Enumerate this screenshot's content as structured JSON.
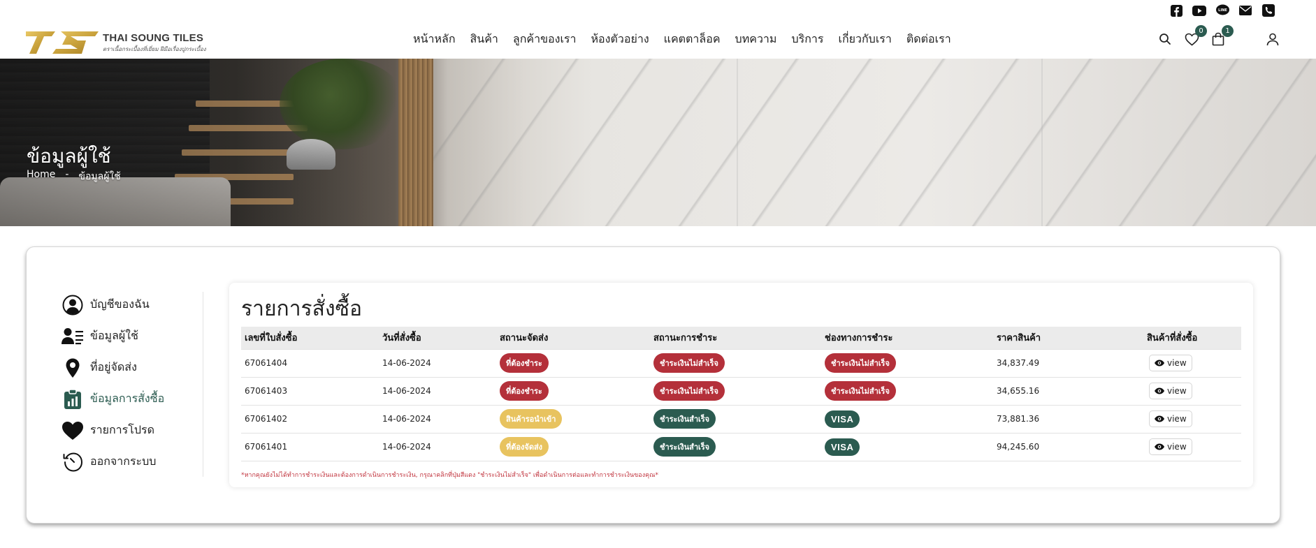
{
  "brand": {
    "name": "THAI SOUNG TILES",
    "tagline": "ตราเนื้อกระเบื้องที่เยี่ยม ฝีมือเรื่องปูกระเบื้อง",
    "accent": "#2b5b50",
    "gold": "#c9a23c"
  },
  "social": [
    "facebook-icon",
    "youtube-icon",
    "line-icon",
    "mail-icon",
    "phone-icon"
  ],
  "nav": [
    {
      "label": "หน้าหลัก"
    },
    {
      "label": "สินค้า"
    },
    {
      "label": "ลูกค้าของเรา"
    },
    {
      "label": "ห้องตัวอย่าง"
    },
    {
      "label": "แคตตาล็อค"
    },
    {
      "label": "บทความ"
    },
    {
      "label": "บริการ"
    },
    {
      "label": "เกี่ยวกับเรา"
    },
    {
      "label": "ติดต่อเรา"
    }
  ],
  "header": {
    "wishlist_count": "0",
    "cart_count": "1"
  },
  "hero": {
    "title": "ข้อมูลผู้ใช้",
    "breadcrumb_home": "Home",
    "breadcrumb_sep": "-",
    "breadcrumb_current": "ข้อมูลผู้ใช้"
  },
  "sidebar": {
    "items": [
      {
        "label": "บัญชีของฉัน",
        "icon": "account-circle-icon"
      },
      {
        "label": "ข้อมูลผู้ใช้",
        "icon": "user-details-icon"
      },
      {
        "label": "ที่อยู่จัดส่ง",
        "icon": "map-pin-icon"
      },
      {
        "label": "ข้อมูลการสั่งซื้อ",
        "icon": "order-clipboard-icon",
        "active": true
      },
      {
        "label": "รายการโปรด",
        "icon": "heart-icon"
      },
      {
        "label": "ออกจากระบบ",
        "icon": "logout-icon"
      }
    ]
  },
  "orders": {
    "title": "รายการสั่งซื้อ",
    "columns": [
      "เลขที่ใบสั่งซื้อ",
      "วันที่สั่งซื้อ",
      "สถานะจัดส่ง",
      "สถานะการชำระ",
      "ช่องทางการชำระ",
      "ราคาสินค้า",
      "สินค้าที่สั่งซื้อ"
    ],
    "rows": [
      {
        "id": "67061404",
        "date": "14-06-2024",
        "shipping": "ที่ต้องชำระ",
        "shipping_color": "red",
        "payment": "ชำระเงินไม่สำเร็จ",
        "payment_color": "red",
        "channel": "ชำระเงินไม่สำเร็จ",
        "channel_type": "red",
        "price": "34,837.49",
        "action": "view"
      },
      {
        "id": "67061403",
        "date": "14-06-2024",
        "shipping": "ที่ต้องชำระ",
        "shipping_color": "red",
        "payment": "ชำระเงินไม่สำเร็จ",
        "payment_color": "red",
        "channel": "ชำระเงินไม่สำเร็จ",
        "channel_type": "red",
        "price": "34,655.16",
        "action": "view"
      },
      {
        "id": "67061402",
        "date": "14-06-2024",
        "shipping": "สินค้ารอนำเข้า",
        "shipping_color": "yellow",
        "payment": "ชำระเงินสำเร็จ",
        "payment_color": "green",
        "channel": "VISA",
        "channel_type": "visa",
        "price": "73,881.36",
        "action": "view"
      },
      {
        "id": "67061401",
        "date": "14-06-2024",
        "shipping": "ที่ต้องจัดส่ง",
        "shipping_color": "yellow",
        "payment": "ชำระเงินสำเร็จ",
        "payment_color": "green",
        "channel": "VISA",
        "channel_type": "visa",
        "price": "94,245.60",
        "action": "view"
      }
    ],
    "note": "*หากคุณยังไม่ได้ทำการชำระเงินและต้องการดำเนินการชำระเงิน, กรุณาคลิกที่ปุ่มสีแดง \"ชำระเงินไม่สำเร็จ\" เพื่อดำเนินการต่อและทำการชำระเงินของคุณ*"
  }
}
